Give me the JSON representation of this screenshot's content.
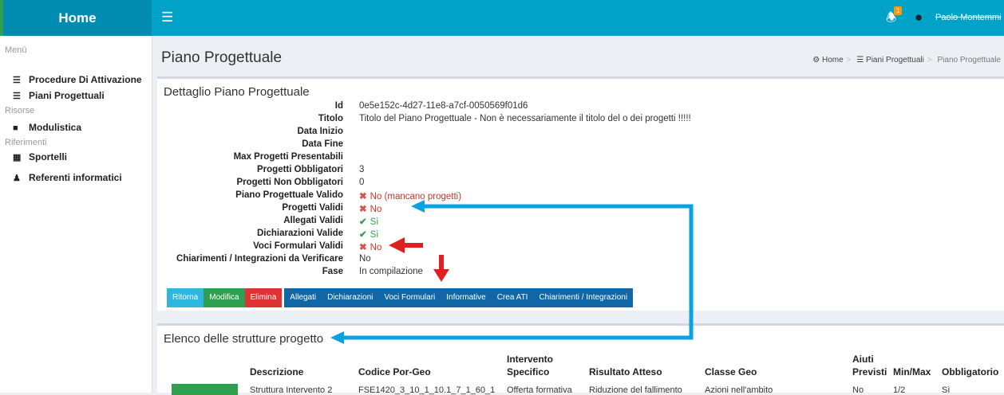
{
  "header": {
    "home": "Home",
    "menu_icon": "hamburger-icon",
    "notification_count": "1",
    "user_name": "Paolo Montemmi"
  },
  "sidebar": {
    "section_menu": "Menù",
    "section_risorse": "Risorse",
    "section_riferimenti": "Riferimenti",
    "items": [
      {
        "label": "Procedure Di Attivazione",
        "icon": "list-icon"
      },
      {
        "label": "Piani Progettuali",
        "icon": "list-icon"
      },
      {
        "label": "Modulistica",
        "icon": "folder-icon"
      },
      {
        "label": "Sportelli",
        "icon": "building-icon"
      },
      {
        "label": "Referenti informatici",
        "icon": "user-icon"
      }
    ]
  },
  "page": {
    "title": "Piano Progettuale"
  },
  "breadcrumb": {
    "home": "Home",
    "parent": "Piani Progettuali",
    "current": "Piano Progettuale"
  },
  "detail": {
    "title": "Dettaglio Piano Progettuale",
    "id_label": "Id",
    "id_value": "0e5e152c-4d27-11e8-a7cf-0050569f01d6",
    "titolo_label": "Titolo",
    "titolo_value": "Titolo del Piano Progettuale - Non è necessariamente il titolo del o dei progetti !!!!!",
    "data_inizio_label": "Data Inizio",
    "data_fine_label": "Data Fine",
    "max_progetti_label": "Max Progetti Presentabili",
    "obbligatori_label": "Progetti Obbligatori",
    "obbligatori_value": "3",
    "non_obbligatori_label": "Progetti Non Obbligatori",
    "non_obbligatori_value": "0",
    "piano_valido_label": "Piano Progettuale Valido",
    "piano_valido_value": "No (mancano progetti)",
    "progetti_validi_label": "Progetti Validi",
    "progetti_validi_value": "No",
    "allegati_validi_label": "Allegati Validi",
    "allegati_validi_value": "Sì",
    "dichiarazioni_label": "Dichiarazioni Valide",
    "dichiarazioni_value": "Sì",
    "voci_label": "Voci Formulari Validi",
    "voci_value": "No",
    "chiarimenti_label": "Chiarimenti / Integrazioni da Verificare",
    "chiarimenti_value": "No",
    "fase_label": "Fase",
    "fase_value": "In compilazione"
  },
  "buttons": {
    "ritorna": "Ritorna",
    "modifica": "Modifica",
    "elimina": "Elimina",
    "allegati": "Allegati",
    "dichiarazioni": "Dichiarazioni",
    "voci": "Voci Formulari",
    "informative": "Informative",
    "crea_ati": "Crea ATI",
    "chiarimenti": "Chiarimenti / Integrazioni"
  },
  "structures": {
    "title": "Elenco delle strutture progetto",
    "columns": {
      "descrizione": "Descrizione",
      "codice": "Codice Por-Geo",
      "intervento_1": "Intervento",
      "intervento_2": "Specifico",
      "risultato": "Risultato Atteso",
      "classe": "Classe Geo",
      "aiuti_1": "Aiuti",
      "aiuti_2": "Previsti",
      "minmax": "Min/Max",
      "obbligatorio": "Obbligatorio"
    },
    "row": {
      "descrizione": "Struttura Intervento 2",
      "codice": "FSE1420_3_10_1_10.1_7_1_60_1",
      "intervento": "Offerta formativa",
      "risultato": "Riduzione del fallimento",
      "classe": "Azioni nell'ambito",
      "aiuti": "No",
      "minmax": "1/2",
      "obbligatorio": "Sì"
    }
  },
  "colors": {
    "topbar": "#00a2c7",
    "annotation_blue": "#0aa3e0",
    "annotation_red": "#e02020"
  }
}
